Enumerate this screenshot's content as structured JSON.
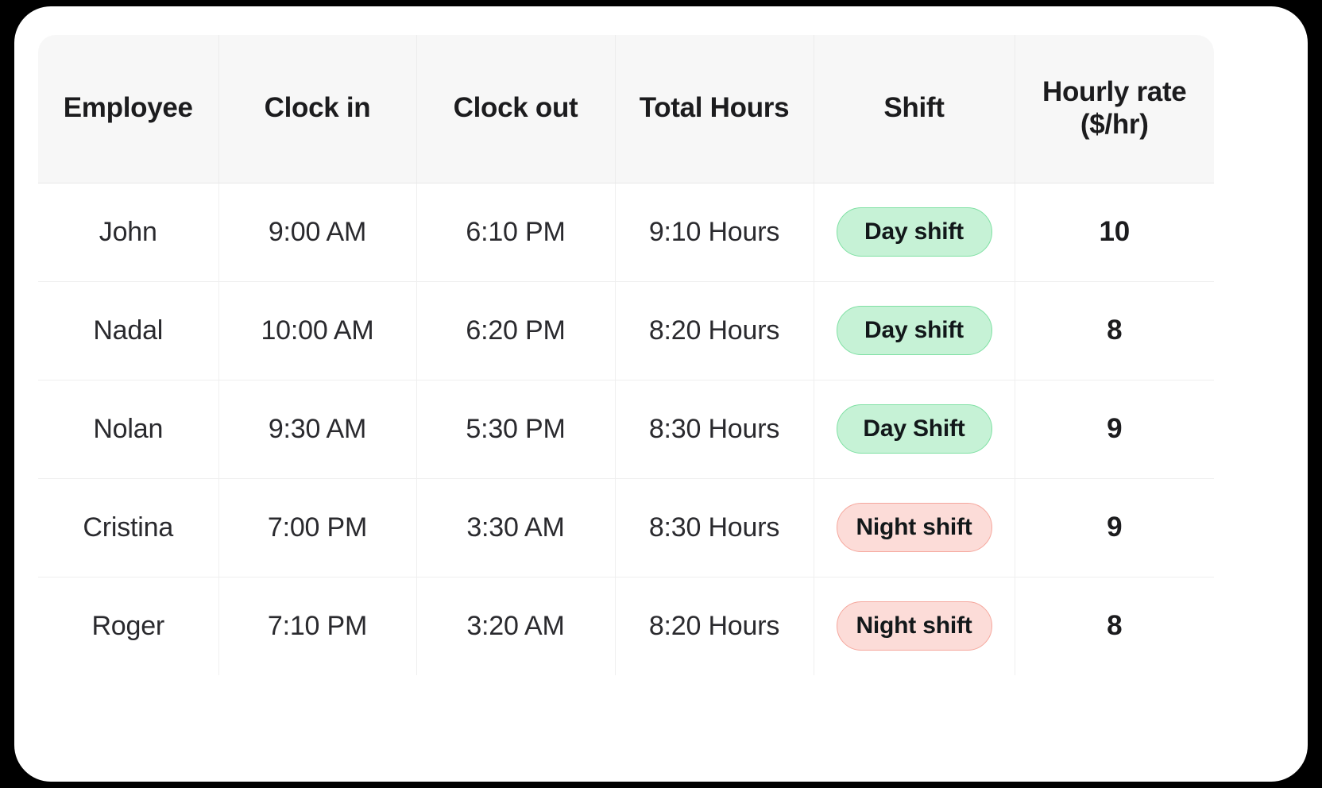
{
  "table": {
    "columns": [
      {
        "key": "employee",
        "label": "Employee",
        "sublabel": ""
      },
      {
        "key": "clock_in",
        "label": "Clock in",
        "sublabel": ""
      },
      {
        "key": "clock_out",
        "label": "Clock out",
        "sublabel": ""
      },
      {
        "key": "total_hours",
        "label": "Total Hours",
        "sublabel": ""
      },
      {
        "key": "shift",
        "label": "Shift",
        "sublabel": ""
      },
      {
        "key": "hourly_rate",
        "label": "Hourly rate",
        "sublabel": "($/hr)"
      }
    ],
    "rows": [
      {
        "employee": "John",
        "clock_in": "9:00 AM",
        "clock_out": "6:10 PM",
        "total_hours": "9:10 Hours",
        "shift": "Day shift",
        "shift_type": "day",
        "hourly_rate": "10"
      },
      {
        "employee": "Nadal",
        "clock_in": "10:00 AM",
        "clock_out": "6:20 PM",
        "total_hours": "8:20 Hours",
        "shift": "Day shift",
        "shift_type": "day",
        "hourly_rate": "8"
      },
      {
        "employee": "Nolan",
        "clock_in": "9:30 AM",
        "clock_out": "5:30 PM",
        "total_hours": "8:30 Hours",
        "shift": "Day Shift",
        "shift_type": "day",
        "hourly_rate": "9"
      },
      {
        "employee": "Cristina",
        "clock_in": "7:00 PM",
        "clock_out": "3:30 AM",
        "total_hours": "8:30 Hours",
        "shift": "Night shift",
        "shift_type": "night",
        "hourly_rate": "9"
      },
      {
        "employee": "Roger",
        "clock_in": "7:10 PM",
        "clock_out": "3:20 AM",
        "total_hours": "8:20 Hours",
        "shift": "Night shift",
        "shift_type": "night",
        "hourly_rate": "8"
      }
    ]
  },
  "colors": {
    "page_background": "#000000",
    "card_background": "#ffffff",
    "header_background": "#f7f7f7",
    "grid_line": "#efefef",
    "text_primary": "#1c1c1e",
    "text_body": "#2a2a2e",
    "badge_day_fill": "#c6f2d6",
    "badge_day_border": "#7fe0a3",
    "badge_night_fill": "#fcdcd8",
    "badge_night_border": "#f5a79d"
  }
}
